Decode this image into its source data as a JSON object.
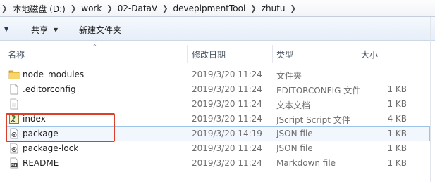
{
  "breadcrumb": {
    "items": [
      "本地磁盘 (D:)",
      "work",
      "02-DataV",
      "deveplpmentTool",
      "zhutu"
    ]
  },
  "toolbar": {
    "share_label": "共享",
    "new_folder_label": "新建文件夹"
  },
  "columns": {
    "name": "名称",
    "date": "修改日期",
    "type": "类型",
    "size": "大小"
  },
  "files": [
    {
      "name": "node_modules",
      "date": "2019/3/20 11:24",
      "type": "文件夹",
      "size": "",
      "icon": "folder-icon"
    },
    {
      "name": ".editorconfig",
      "date": "2019/3/20 11:24",
      "type": "EDITORCONFIG 文件",
      "size": "1 KB",
      "icon": "blank-file-icon"
    },
    {
      "name": "",
      "date": "2019/3/20 11:24",
      "type": "文本文档",
      "size": "1 KB",
      "icon": "text-file-icon"
    },
    {
      "name": "index",
      "date": "2019/3/20 11:24",
      "type": "JScript Script 文件",
      "size": "4 KB",
      "icon": "jscript-file-icon"
    },
    {
      "name": "package",
      "date": "2019/3/20 14:19",
      "type": "JSON file",
      "size": "1 KB",
      "icon": "json-file-icon"
    },
    {
      "name": "package-lock",
      "date": "2019/3/20 11:24",
      "type": "JSON file",
      "size": "1 KB",
      "icon": "json-file-icon"
    },
    {
      "name": "README",
      "date": "2019/3/20 11:24",
      "type": "Markdown file",
      "size": "1 KB",
      "icon": "markdown-file-icon"
    }
  ],
  "colors": {
    "annotation_box": "#d9412b",
    "row_highlight_border": "#9cc2e8",
    "folder": "#e8b93e"
  }
}
